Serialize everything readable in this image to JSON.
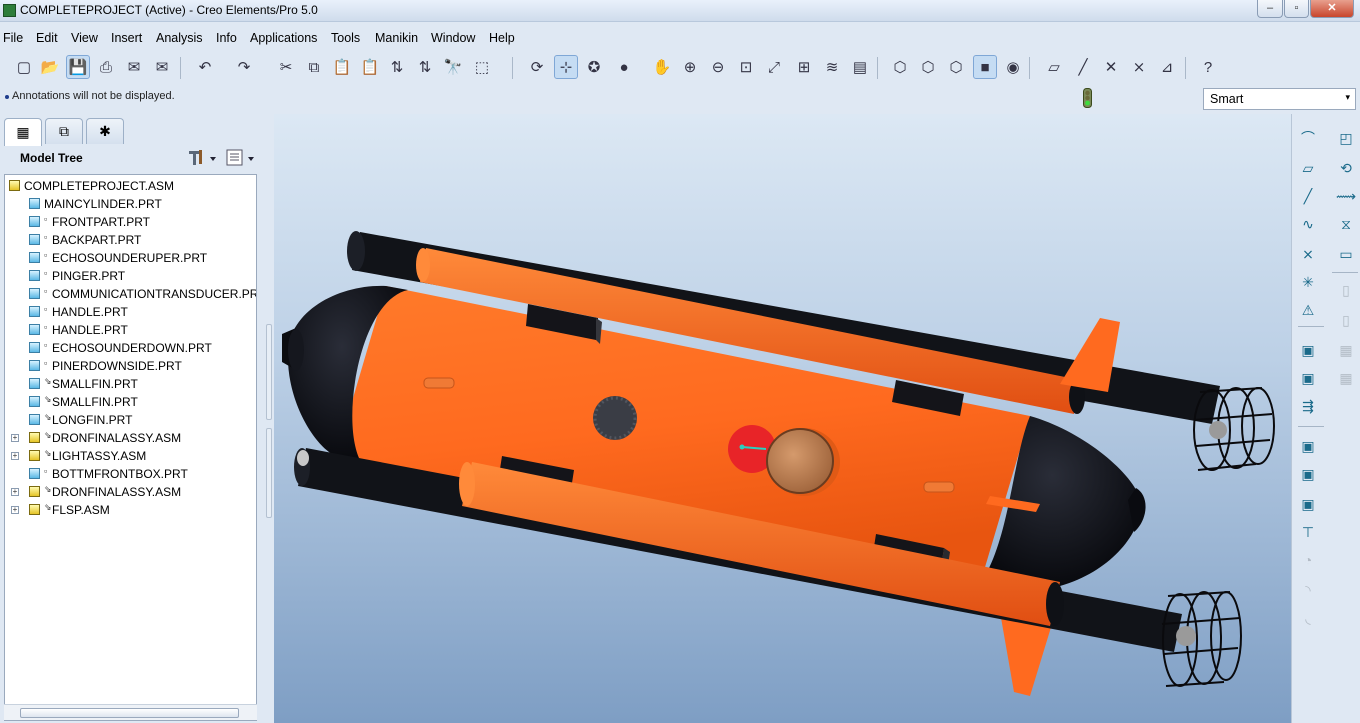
{
  "window": {
    "title": "COMPLETEPROJECT (Active) - Creo Elements/Pro 5.0",
    "min": "–",
    "max": "▫",
    "close": "✕"
  },
  "menu": [
    "File",
    "Edit",
    "View",
    "Insert",
    "Analysis",
    "Info",
    "Applications",
    "Tools",
    "Manikin",
    "Window",
    "Help"
  ],
  "toolbar": {
    "groups": [
      [
        "new-file-icon",
        "open-folder-icon",
        "save-icon",
        "print-icon",
        "send-mail-icon",
        "mail-attach-icon"
      ],
      [
        "undo-icon",
        "redo-icon",
        "cut-icon",
        "copy-icon",
        "paste-icon",
        "paste-special-icon",
        "regenerate-icon",
        "regen-manager-icon",
        "find-icon",
        "select-box-icon"
      ],
      [
        "repaint-icon",
        "spin-center-icon",
        "orient-mode-icon",
        "shading-icon",
        "pan-icon",
        "zoom-in-icon",
        "zoom-out-icon",
        "refit-icon",
        "reorient-icon",
        "saved-views-icon",
        "layers-icon",
        "view-manager-icon"
      ],
      [
        "wireframe-icon",
        "hidden-line-icon",
        "no-hidden-icon",
        "shaded-icon",
        "enhanced-realism-icon"
      ],
      [
        "datum-planes-icon",
        "datum-axes-icon",
        "datum-points-icon",
        "coord-sys-icon",
        "annotations-icon"
      ],
      [
        "context-help-icon"
      ]
    ],
    "glyphs": [
      "▢",
      "📂",
      "💾",
      "⎙",
      "✉",
      "✉",
      "↶",
      "↷",
      "✂",
      "⧉",
      "📋",
      "📋",
      "⇅",
      "⇅",
      "🔭",
      "⬚",
      "⟳",
      "⊹",
      "✪",
      "●",
      "✋",
      "⊕",
      "⊖",
      "⊡",
      "⤢",
      "⊞",
      "≋",
      "▤",
      "⬡",
      "⬡",
      "⬡",
      "■",
      "◉",
      "▱",
      "╱",
      "✕",
      "⨯",
      "⊿",
      "?"
    ]
  },
  "status": {
    "message": "Annotations will not be displayed."
  },
  "filter": {
    "selected": "Smart",
    "arrow": "▾"
  },
  "model_tree": {
    "title": "Model Tree",
    "tabs": [
      "▦",
      "⧉",
      "✱"
    ],
    "items": [
      {
        "label": "COMPLETEPROJECT.ASM",
        "type": "asm",
        "level": 0,
        "expander": false
      },
      {
        "label": "MAINCYLINDER.PRT",
        "type": "prt",
        "level": 1,
        "marker": ""
      },
      {
        "label": "FRONTPART.PRT",
        "type": "prt",
        "level": 1,
        "marker": "▫"
      },
      {
        "label": "BACKPART.PRT",
        "type": "prt",
        "level": 1,
        "marker": "▫"
      },
      {
        "label": "ECHOSOUNDERUPER.PRT",
        "type": "prt",
        "level": 1,
        "marker": "▫"
      },
      {
        "label": "PINGER.PRT",
        "type": "prt",
        "level": 1,
        "marker": "▫"
      },
      {
        "label": "COMMUNICATIONTRANSDUCER.PRT",
        "type": "prt",
        "level": 1,
        "marker": "▫"
      },
      {
        "label": "HANDLE.PRT",
        "type": "prt",
        "level": 1,
        "marker": "▫"
      },
      {
        "label": "HANDLE.PRT",
        "type": "prt",
        "level": 1,
        "marker": "▫"
      },
      {
        "label": "ECHOSOUNDERDOWN.PRT",
        "type": "prt",
        "level": 1,
        "marker": "▫"
      },
      {
        "label": "PINERDOWNSIDE.PRT",
        "type": "prt",
        "level": 1,
        "marker": "▫"
      },
      {
        "label": "SMALLFIN.PRT",
        "type": "prt",
        "level": 1,
        "marker": "⇘"
      },
      {
        "label": "SMALLFIN.PRT",
        "type": "prt",
        "level": 1,
        "marker": "⇘"
      },
      {
        "label": "LONGFIN.PRT",
        "type": "prt",
        "level": 1,
        "marker": "⇘"
      },
      {
        "label": "DRONFINALASSY.ASM",
        "type": "asm",
        "level": 1,
        "marker": "⇘",
        "expander": true
      },
      {
        "label": "LIGHTASSY.ASM",
        "type": "asm",
        "level": 1,
        "marker": "⇘",
        "expander": true
      },
      {
        "label": "BOTTMFRONTBOX.PRT",
        "type": "prt",
        "level": 1,
        "marker": "▫"
      },
      {
        "label": "DRONFINALASSY.ASM",
        "type": "asm",
        "level": 1,
        "marker": "⇘",
        "expander": true
      },
      {
        "label": "FLSP.ASM",
        "type": "asm",
        "level": 1,
        "marker": "⇘",
        "expander": true
      }
    ],
    "expander_glyph": "+"
  },
  "right_toolbar": {
    "col1": [
      "sketch-datum-icon",
      "datum-plane-icon",
      "datum-axis-icon",
      "datum-curve-icon",
      "datum-point-icon",
      "offset-point-icon",
      "field-point-icon",
      "insert-component-icon",
      "create-component-icon",
      "package-icon",
      "assemble-icon",
      "create-part-icon",
      "copy-geometry-icon",
      "hole-icon",
      "round-icon",
      "chamfer-icon",
      "draft-icon"
    ],
    "col2": [
      "extrude-icon",
      "revolve-icon",
      "sweep-icon",
      "blend-icon",
      "boundary-icon",
      "shell-icon",
      "rib-icon",
      "pattern-icon",
      "mirror-icon"
    ],
    "glyphs": [
      "⌒",
      "▱",
      "╱",
      "∿",
      "⨯",
      "✳",
      "⚠",
      "▣",
      "▣",
      "⇶",
      "▣",
      "▣",
      "▣",
      "⊤",
      "◔",
      "◝",
      "◟",
      "◰",
      "⟲",
      "⟿",
      "⧖",
      "▭",
      "▯",
      "▯",
      "▦",
      "▦"
    ]
  },
  "colors": {
    "body_orange": "#ff6a1f",
    "nose_black": "#0c0e14",
    "pad_black": "#141419",
    "lid_brown": "#b77a4e",
    "sensor_red": "#e82428"
  }
}
